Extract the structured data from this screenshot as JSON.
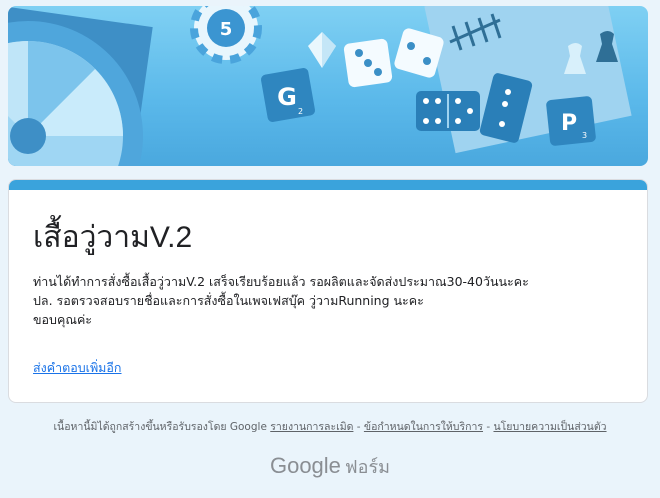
{
  "form": {
    "title": "เสื้อวู่วามV.2",
    "message_lines": [
      "ท่านได้ทำการสั่งซื้อเสื้อวู่วามV.2 เสร็จเรียบร้อยแล้ว รอผลิตและจัดส่งประมาณ30-40วันนะคะ",
      "ปล. รอตรวจสอบรายชื่อและการสั่งซื้อในเพจเฟสบุ๊ค วู่วามRunning นะคะ",
      "ขอบคุณค่ะ"
    ],
    "submit_another_label": "ส่งคำตอบเพิ่มอีก"
  },
  "footer": {
    "disclaimer": "เนื้อหานี้มิได้ถูกสร้างขึ้นหรือรับรองโดย Google",
    "report_abuse": "รายงานการละเมิด",
    "terms": "ข้อกำหนดในการให้บริการ",
    "privacy": "นโยบายความเป็นส่วนตัว",
    "separator": " - "
  },
  "brand": {
    "google": "Google",
    "forms": "ฟอร์ม"
  },
  "banner": {
    "chip_number": "5",
    "tile_g_letter": "G",
    "tile_g_score": "2",
    "tile_p_letter": "P",
    "tile_p_score": "3"
  },
  "colors": {
    "accent": "#3aa3dc",
    "link": "#1a73e8",
    "background": "#eaf4fb"
  }
}
